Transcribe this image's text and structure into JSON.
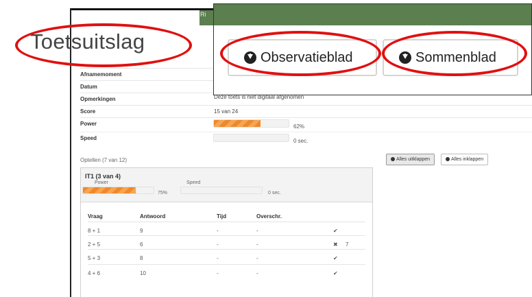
{
  "title": "Toetsuitslag",
  "topbar_text": "Ri",
  "buttons": {
    "observatieblad": "Observatieblad",
    "sommenblad": "Sommenblad"
  },
  "info": [
    {
      "label": "Afnamemoment",
      "value": ""
    },
    {
      "label": "Datum",
      "value": ""
    },
    {
      "label": "Opmerkingen",
      "value": "Deze toets is niet digitaal afgenomen"
    },
    {
      "label": "Score",
      "value": "15 van 24"
    },
    {
      "label": "Power",
      "value": "62%"
    },
    {
      "label": "Speed",
      "value": "0 sec."
    }
  ],
  "power_fraction": 0.62,
  "speed_fraction": 0,
  "section_label": "Optellen (7 van 12)",
  "alles_uitklappen": "Alles uitklappen",
  "alles_inklappen": "Alles inklappen",
  "panel": {
    "title": "IT1 (3 van 4)",
    "power_label": "Power",
    "speed_label": "Speed",
    "power_value": "75%",
    "power_fraction": 0.75,
    "speed_value": "0 sec."
  },
  "table": {
    "headers": [
      "Vraag",
      "Antwoord",
      "Tijd",
      "Overschr."
    ],
    "rows": [
      {
        "vraag": "8 + 1",
        "antwoord": "9",
        "tijd": "-",
        "overschr": "-",
        "mark": "✔",
        "correction": ""
      },
      {
        "vraag": "2 + 5",
        "antwoord": "6",
        "tijd": "-",
        "overschr": "-",
        "mark": "✖",
        "correction": "7"
      },
      {
        "vraag": "5 + 3",
        "antwoord": "8",
        "tijd": "-",
        "overschr": "-",
        "mark": "✔",
        "correction": ""
      },
      {
        "vraag": "4 + 6",
        "antwoord": "10",
        "tijd": "-",
        "overschr": "-",
        "mark": "✔",
        "correction": ""
      }
    ]
  },
  "colors": {
    "header_green": "#5b7f4f",
    "progress_orange": "#f0882a",
    "annotation_red": "#e01010"
  }
}
